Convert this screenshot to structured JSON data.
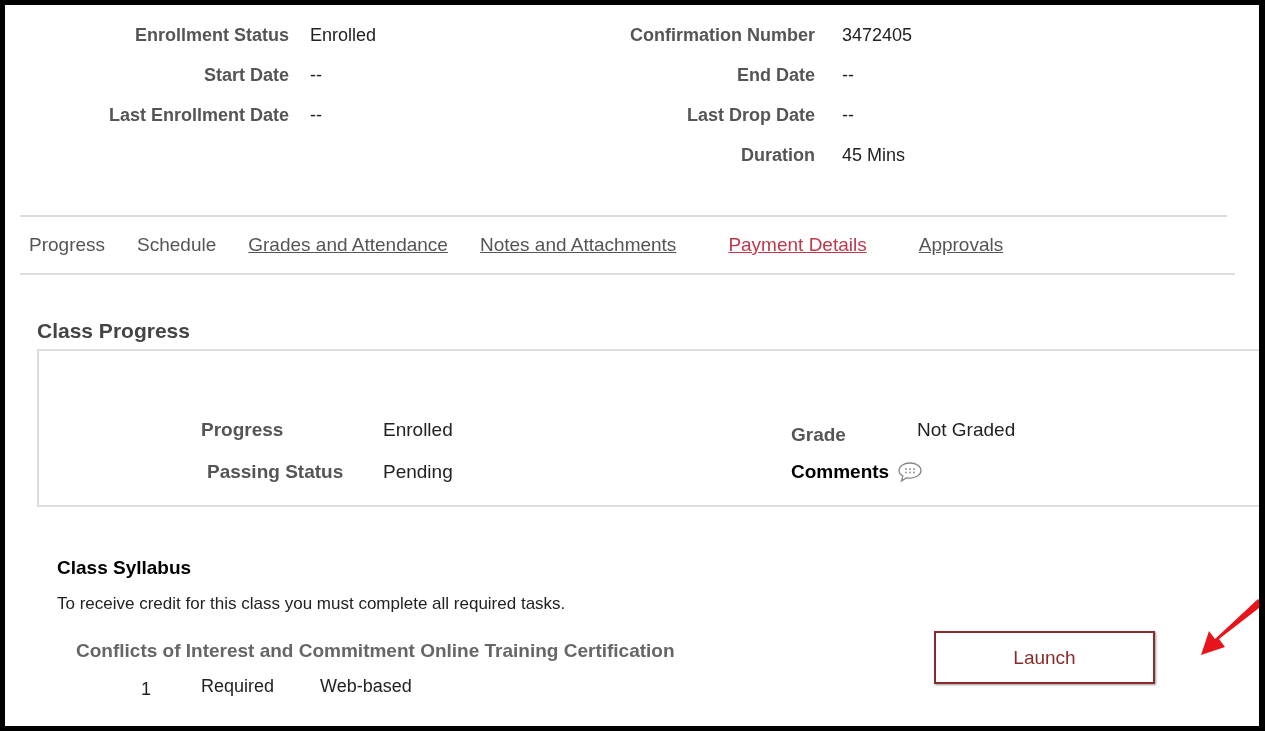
{
  "enrollment_details": {
    "left": [
      {
        "label": "Enrollment Status",
        "value": "Enrolled"
      },
      {
        "label": "Start Date",
        "value": "--"
      },
      {
        "label": "Last Enrollment Date",
        "value": "--"
      }
    ],
    "right": [
      {
        "label": "Confirmation Number",
        "value": "3472405"
      },
      {
        "label": "End Date",
        "value": "--"
      },
      {
        "label": "Last Drop Date",
        "value": "--"
      },
      {
        "label": "Duration",
        "value": "45 Mins"
      }
    ]
  },
  "tabs": [
    {
      "label": "Progress",
      "kind": "text"
    },
    {
      "label": "Schedule",
      "kind": "text"
    },
    {
      "label": "Grades and Attendance",
      "kind": "link"
    },
    {
      "label": "Notes and Attachments",
      "kind": "link"
    },
    {
      "label": "Payment Details",
      "kind": "hover-link"
    },
    {
      "label": "Approvals",
      "kind": "link"
    }
  ],
  "class_progress": {
    "title": "Class Progress",
    "progress_label": "Progress",
    "progress": "Enrolled",
    "passing_status_label": "Passing Status",
    "passing_status": "Pending",
    "grade_label": "Grade",
    "grade": "Not Graded",
    "comments_label": "Comments"
  },
  "class_syllabus": {
    "title": "Class Syllabus",
    "instructions": "To receive credit for this class you must complete all required tasks.",
    "tasks": [
      {
        "title": "Conflicts of Interest and Commitment Online Training Certification",
        "number": "1",
        "requirement": "Required",
        "delivery": "Web-based",
        "button": "Launch"
      }
    ]
  }
}
